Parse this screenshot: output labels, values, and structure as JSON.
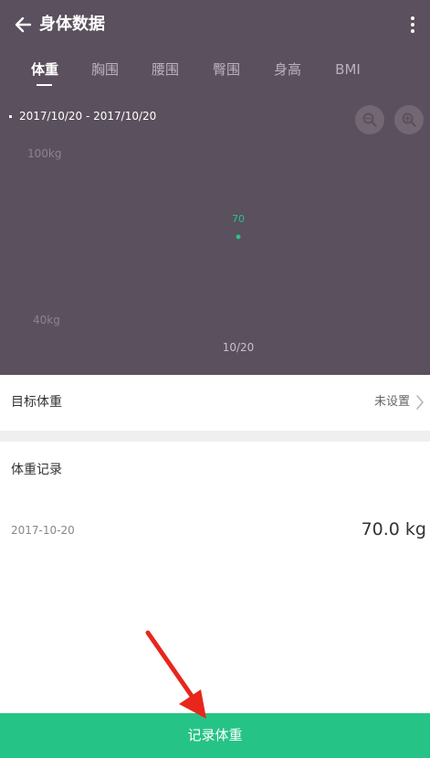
{
  "app": {
    "title": "身体数据"
  },
  "tabs": [
    {
      "label": "体重",
      "active": true
    },
    {
      "label": "胸围",
      "active": false
    },
    {
      "label": "腰围",
      "active": false
    },
    {
      "label": "臀围",
      "active": false
    },
    {
      "label": "身高",
      "active": false
    },
    {
      "label": "BMI",
      "active": false
    }
  ],
  "chart": {
    "date_range": "2017/10/20 - 2017/10/20",
    "icons": [
      "zoom-out-icon",
      "zoom-in-icon"
    ]
  },
  "chart_data": {
    "type": "scatter",
    "x": [
      "10/20"
    ],
    "values": [
      70
    ],
    "data_labels": [
      "70"
    ],
    "y_ticks": [
      "100kg",
      "40kg"
    ],
    "x_ticks": [
      "10/20"
    ],
    "ylim": [
      40,
      100
    ],
    "grid": false,
    "point_color": "#26c386"
  },
  "goal": {
    "label": "目标体重",
    "value": "未设置"
  },
  "records": {
    "title": "体重记录",
    "items": [
      {
        "date": "2017-10-20",
        "weight": "70.0 kg"
      }
    ]
  },
  "actions": {
    "record_weight": "记录体重"
  },
  "colors": {
    "header_bg": "#5b505e",
    "accent": "#26c386",
    "annotation_arrow": "#e8261c"
  }
}
